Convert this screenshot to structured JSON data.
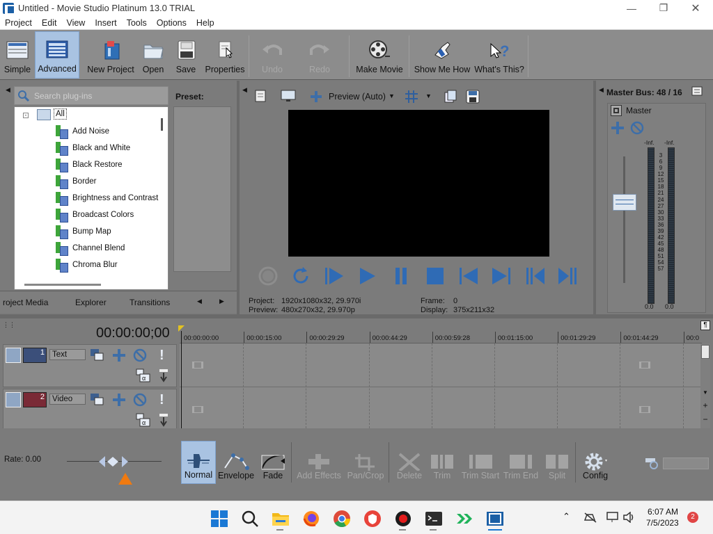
{
  "window": {
    "title": "Untitled - Movie Studio Platinum 13.0 TRIAL",
    "minimize_icon": "minimize-icon",
    "maximize_icon": "restore-icon",
    "close_icon": "close-icon"
  },
  "menu": [
    "Project",
    "Edit",
    "View",
    "Insert",
    "Tools",
    "Options",
    "Help"
  ],
  "toolbar": {
    "simple": "Simple",
    "advanced": "Advanced",
    "new_project": "New Project",
    "open": "Open",
    "save": "Save",
    "properties": "Properties",
    "undo": "Undo",
    "redo": "Redo",
    "make_movie": "Make Movie",
    "show_me_how": "Show Me How",
    "whats_this": "What's This?"
  },
  "plugins": {
    "search_placeholder": "Search plug-ins",
    "preset_label": "Preset:",
    "root": "All",
    "items": [
      "Add Noise",
      "Black and White",
      "Black Restore",
      "Border",
      "Brightness and Contrast",
      "Broadcast Colors",
      "Bump Map",
      "Channel Blend",
      "Chroma Blur"
    ]
  },
  "tabs": [
    "roject Media",
    "Explorer",
    "Transitions"
  ],
  "preview": {
    "mode": "Preview (Auto)",
    "project_label": "Project:",
    "project_value": "1920x1080x32, 29.970i",
    "preview_label": "Preview:",
    "preview_value": "480x270x32, 29.970p",
    "frame_label": "Frame:",
    "frame_value": "0",
    "display_label": "Display:",
    "display_value": "375x211x32"
  },
  "master": {
    "title": "Master Bus: 48 / 16",
    "label": "Master",
    "peak_left": "-Inf.",
    "peak_right": "-Inf.",
    "scale": [
      "3",
      "6",
      "9",
      "12",
      "15",
      "18",
      "21",
      "24",
      "27",
      "30",
      "33",
      "36",
      "39",
      "42",
      "45",
      "48",
      "51",
      "54",
      "57"
    ],
    "level_left": "0.0",
    "level_right": "0.0"
  },
  "timeline": {
    "timecode": "00:00:00;00",
    "ruler": [
      "00:00:00:00",
      "00:00:15:00",
      "00:00:29:29",
      "00:00:44:29",
      "00:00:59:28",
      "00:01:15:00",
      "00:01:29:29",
      "00:01:44:29",
      "00:0"
    ],
    "tracks": [
      {
        "number": "1",
        "name": "Text"
      },
      {
        "number": "2",
        "name": "Video"
      }
    ],
    "rate": "Rate: 0.00"
  },
  "edit_tools": {
    "normal": "Normal",
    "envelope": "Envelope",
    "fade": "Fade",
    "add_effects": "Add Effects",
    "pan_crop": "Pan/Crop",
    "delete": "Delete",
    "trim": "Trim",
    "trim_start": "Trim Start",
    "trim_end": "Trim End",
    "split": "Split",
    "config": "Config"
  },
  "taskbar": {
    "time": "6:07 AM",
    "date": "7/5/2023",
    "notifications": "2"
  },
  "colors": {
    "accent_selected": "#a9c3e2",
    "panel_bg": "#7b7b7b",
    "fx_green": "#3ea53a",
    "fx_blue": "#5f83c9",
    "orange": "#f07a10"
  }
}
